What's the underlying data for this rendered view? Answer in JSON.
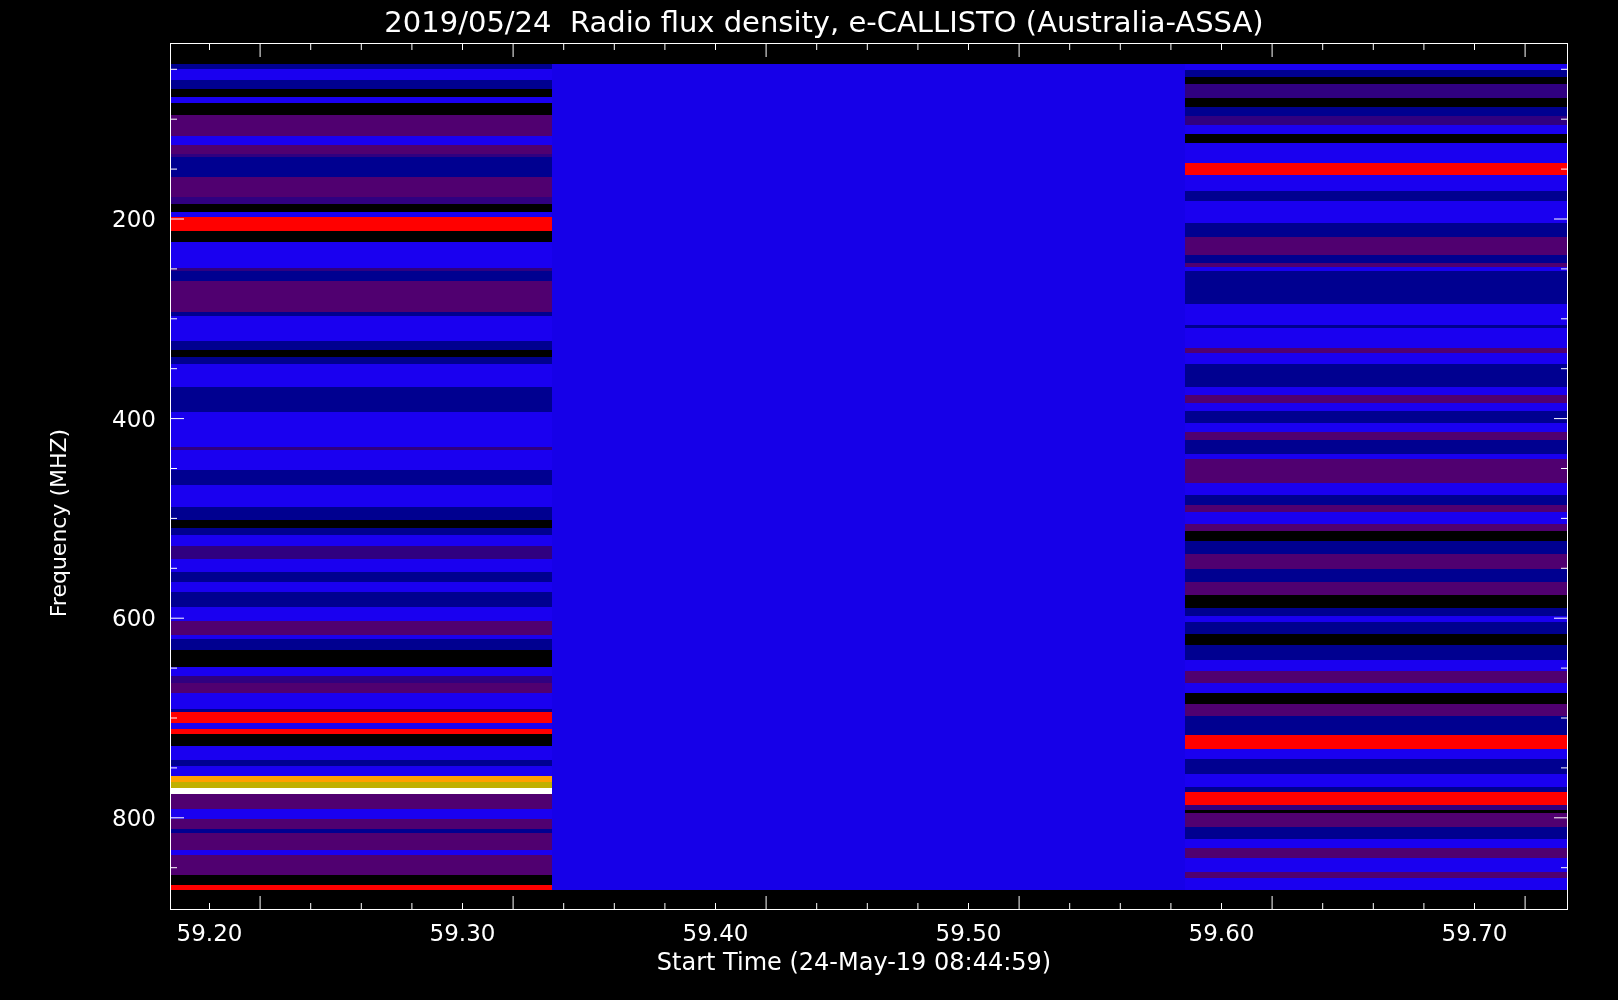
{
  "title": "2019/05/24  Radio flux density, e-CALLISTO (Australia-ASSA)",
  "y_axis": {
    "label": "Frequency (MHZ)",
    "ticks": [
      "200",
      "400",
      "600",
      "800"
    ]
  },
  "x_axis": {
    "label": "Start Time (24-May-19 08:44:59)",
    "ticks": [
      "59.20",
      "59.30",
      "59.40",
      "59.50",
      "59.60",
      "59.70"
    ]
  }
}
